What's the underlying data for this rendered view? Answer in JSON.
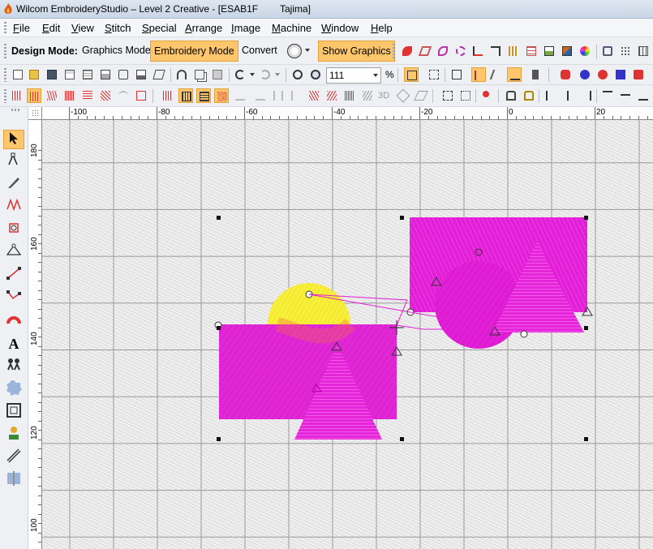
{
  "window": {
    "app_title": "Wilcom EmbroideryStudio – Level 2 Creative - [ESAB1F",
    "machine": "Tajima]",
    "app_icon": "flame-icon"
  },
  "menu": [
    {
      "label": "File",
      "underline": "F",
      "rest": "ile"
    },
    {
      "label": "Edit",
      "underline": "E",
      "rest": "dit"
    },
    {
      "label": "View",
      "underline": "V",
      "rest": "iew"
    },
    {
      "label": "Stitch",
      "underline": "S",
      "rest": "titch"
    },
    {
      "label": "Special",
      "underline": "S",
      "rest": "pecial"
    },
    {
      "label": "Arrange",
      "underline": "A",
      "rest": "rrange"
    },
    {
      "label": "Image",
      "underline": "I",
      "rest": "mage"
    },
    {
      "label": "Machine",
      "underline": "M",
      "rest": "achine"
    },
    {
      "label": "Window",
      "underline": "W",
      "rest": "indow"
    },
    {
      "label": "Help",
      "underline": "H",
      "rest": "elp"
    }
  ],
  "mode_toolbar": {
    "label": "Design Mode:",
    "graphics_mode": "Graphics Mode",
    "embroidery_mode": "Embroidery Mode",
    "convert": "Convert",
    "show_graphics": "Show Graphics",
    "active_mode": "Embroidery Mode"
  },
  "zoom": {
    "value": "111",
    "unit": "%"
  },
  "ruler": {
    "h_labels": [
      "-100",
      "-80",
      "-60",
      "-40",
      "-20",
      "0",
      "20"
    ],
    "v_labels": [
      "180",
      "160",
      "140",
      "120",
      "100"
    ]
  },
  "colors": {
    "accent": "#ffc66b",
    "magenta": "#e21fd6",
    "yellow": "#f7ef3a",
    "canvas_bg": "#e9e9e9"
  }
}
